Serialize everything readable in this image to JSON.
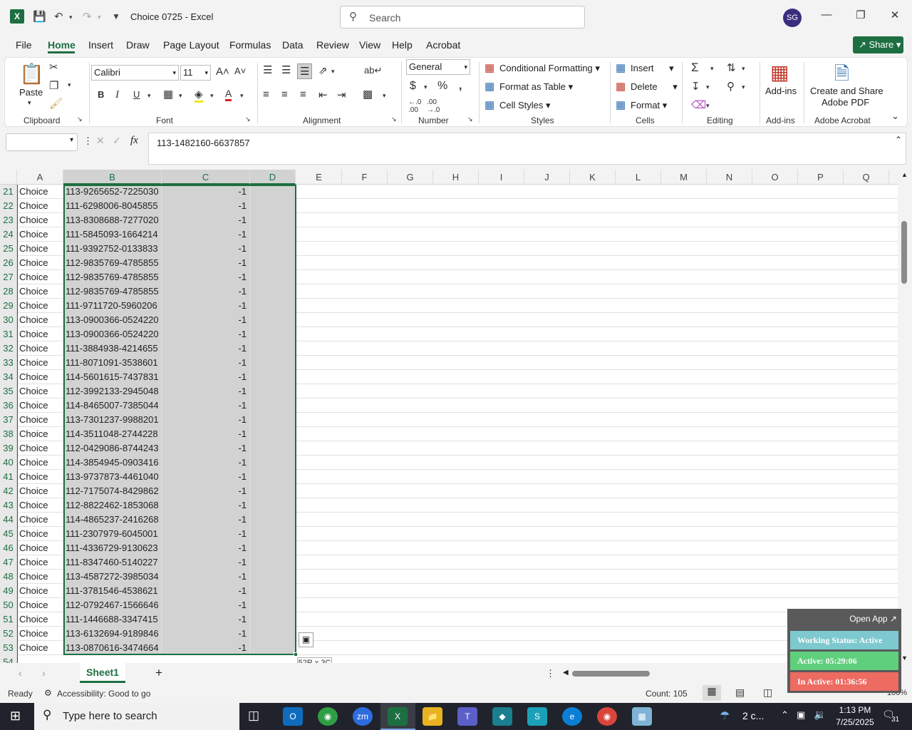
{
  "titlebar": {
    "app_logo": "X",
    "doc_title": "Choice 0725  -  Excel",
    "search_placeholder": "Search",
    "avatar": "SG"
  },
  "tabs": [
    "File",
    "Home",
    "Insert",
    "Draw",
    "Page Layout",
    "Formulas",
    "Data",
    "Review",
    "View",
    "Help",
    "Acrobat"
  ],
  "active_tab": "Home",
  "share_label": "Share",
  "ribbon": {
    "paste": "Paste",
    "font_name": "Calibri",
    "font_size": "11",
    "number_format": "General",
    "conditional_formatting": "Conditional Formatting",
    "format_as_table": "Format as Table",
    "cell_styles": "Cell Styles",
    "insert": "Insert",
    "delete": "Delete",
    "format": "Format",
    "addins": "Add-ins",
    "create_share_line1": "Create and Share",
    "create_share_line2": "Adobe PDF",
    "groups": {
      "clipboard": "Clipboard",
      "font": "Font",
      "alignment": "Alignment",
      "number": "Number",
      "styles": "Styles",
      "cells": "Cells",
      "editing": "Editing",
      "addins": "Add-ins",
      "adobe": "Adobe Acrobat"
    }
  },
  "formula_bar": {
    "fx": "fx",
    "content": "113-1482160-6637857"
  },
  "columns": [
    "A",
    "B",
    "C",
    "D",
    "E",
    "F",
    "G",
    "H",
    "I",
    "J",
    "K",
    "L",
    "M",
    "N",
    "O",
    "P",
    "Q"
  ],
  "rows": [
    {
      "n": "21",
      "a": "Choice",
      "b": "113-9265652-7225030",
      "c": "-1"
    },
    {
      "n": "22",
      "a": "Choice",
      "b": "111-6298006-8045855",
      "c": "-1"
    },
    {
      "n": "23",
      "a": "Choice",
      "b": "113-8308688-7277020",
      "c": "-1"
    },
    {
      "n": "24",
      "a": "Choice",
      "b": "111-5845093-1664214",
      "c": "-1"
    },
    {
      "n": "25",
      "a": "Choice",
      "b": "111-9392752-0133833",
      "c": "-1"
    },
    {
      "n": "26",
      "a": "Choice",
      "b": "112-9835769-4785855",
      "c": "-1"
    },
    {
      "n": "27",
      "a": "Choice",
      "b": "112-9835769-4785855",
      "c": "-1"
    },
    {
      "n": "28",
      "a": "Choice",
      "b": "112-9835769-4785855",
      "c": "-1"
    },
    {
      "n": "29",
      "a": "Choice",
      "b": "111-9711720-5960206",
      "c": "-1"
    },
    {
      "n": "30",
      "a": "Choice",
      "b": "113-0900366-0524220",
      "c": "-1"
    },
    {
      "n": "31",
      "a": "Choice",
      "b": "113-0900366-0524220",
      "c": "-1"
    },
    {
      "n": "32",
      "a": "Choice",
      "b": "111-3884938-4214655",
      "c": "-1"
    },
    {
      "n": "33",
      "a": "Choice",
      "b": "111-8071091-3538601",
      "c": "-1"
    },
    {
      "n": "34",
      "a": "Choice",
      "b": "114-5601615-7437831",
      "c": "-1"
    },
    {
      "n": "35",
      "a": "Choice",
      "b": "112-3992133-2945048",
      "c": "-1"
    },
    {
      "n": "36",
      "a": "Choice",
      "b": "114-8465007-7385044",
      "c": "-1"
    },
    {
      "n": "37",
      "a": "Choice",
      "b": "113-7301237-9988201",
      "c": "-1"
    },
    {
      "n": "38",
      "a": "Choice",
      "b": "114-3511048-2744228",
      "c": "-1"
    },
    {
      "n": "39",
      "a": "Choice",
      "b": "112-0429086-8744243",
      "c": "-1"
    },
    {
      "n": "40",
      "a": "Choice",
      "b": "114-3854945-0903416",
      "c": "-1"
    },
    {
      "n": "41",
      "a": "Choice",
      "b": "113-9737873-4461040",
      "c": "-1"
    },
    {
      "n": "42",
      "a": "Choice",
      "b": "112-7175074-8429862",
      "c": "-1"
    },
    {
      "n": "43",
      "a": "Choice",
      "b": "112-8822462-1853068",
      "c": "-1"
    },
    {
      "n": "44",
      "a": "Choice",
      "b": "114-4865237-2416268",
      "c": "-1"
    },
    {
      "n": "45",
      "a": "Choice",
      "b": "111-2307979-6045001",
      "c": "-1"
    },
    {
      "n": "46",
      "a": "Choice",
      "b": "111-4336729-9130623",
      "c": "-1"
    },
    {
      "n": "47",
      "a": "Choice",
      "b": "111-8347460-5140227",
      "c": "-1"
    },
    {
      "n": "48",
      "a": "Choice",
      "b": "113-4587272-3985034",
      "c": "-1"
    },
    {
      "n": "49",
      "a": "Choice",
      "b": "111-3781546-4538621",
      "c": "-1"
    },
    {
      "n": "50",
      "a": "Choice",
      "b": "112-0792467-1566646",
      "c": "-1"
    },
    {
      "n": "51",
      "a": "Choice",
      "b": "111-1446688-3347415",
      "c": "-1"
    },
    {
      "n": "52",
      "a": "Choice",
      "b": "113-6132694-9189846",
      "c": "-1"
    },
    {
      "n": "53",
      "a": "Choice",
      "b": "113-0870616-3474664",
      "c": "-1"
    }
  ],
  "partial_row": "54",
  "selection_tip": "52R x 3C",
  "sheet_tab": "Sheet1",
  "status": {
    "ready": "Ready",
    "accessibility": "Accessibility: Good to go",
    "count": "Count: 105",
    "zoom": "100%"
  },
  "widget": {
    "open_app": "Open App ↗",
    "working": "Working Status: Active",
    "active": "Active: 05:29:06",
    "inactive": "In Active: 01:36:56",
    "colors": {
      "working": "#7ec8cf",
      "active": "#5fcf7d",
      "inactive": "#ee6b61"
    }
  },
  "taskbar": {
    "search_placeholder": "Type here to search",
    "weather": "2 c...",
    "time": "1:13 PM",
    "date": "7/25/2025",
    "notifications": "31"
  }
}
